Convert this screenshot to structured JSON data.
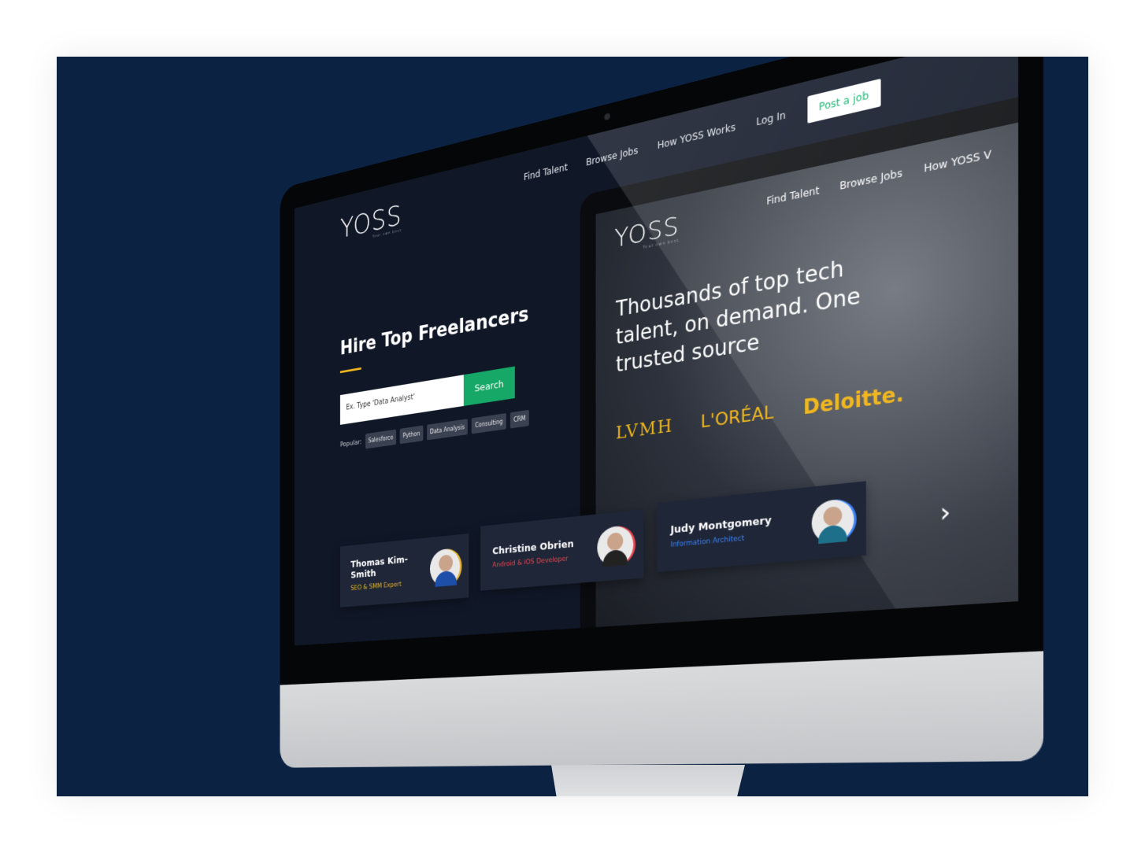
{
  "site": {
    "logo": "YOSS",
    "logo_tagline": "Your own boss",
    "nav": [
      "Find Talent",
      "Browse Jobs",
      "How YOSS Works",
      "Log In"
    ],
    "post_job": "Post a job"
  },
  "hero": {
    "headline": "Hire Top Freelancers",
    "search_placeholder": "Ex. Type 'Data Analyst'",
    "search_button": "Search",
    "popular_label": "Popular:",
    "tags": [
      "Salesforce",
      "Python",
      "Data Analysis",
      "Consulting",
      "CRM"
    ]
  },
  "preview": {
    "logo": "YOSS",
    "logo_tagline": "Your own boss",
    "nav": [
      "Find Talent",
      "Browse Jobs",
      "How YOSS V"
    ],
    "tagline": "Thousands of top tech talent, on demand. One trusted source",
    "brands": [
      "LVMH",
      "L'ORÉAL",
      "Deloitte."
    ]
  },
  "freelancers": [
    {
      "name": "Thomas Kim-Smith",
      "role": "SEO & SMM Expert",
      "color": "#e8b52c"
    },
    {
      "name": "Christine Obrien",
      "role": "Android & iOS Developer",
      "color": "#e5484d"
    },
    {
      "name": "Judy Montgomery",
      "role": "Information Architect",
      "color": "#3b82f6"
    }
  ],
  "colors": {
    "background": "#0b2242",
    "accent_green": "#15a866",
    "accent_yellow": "#f0b71f"
  },
  "next_icon": "chevron-right-icon"
}
